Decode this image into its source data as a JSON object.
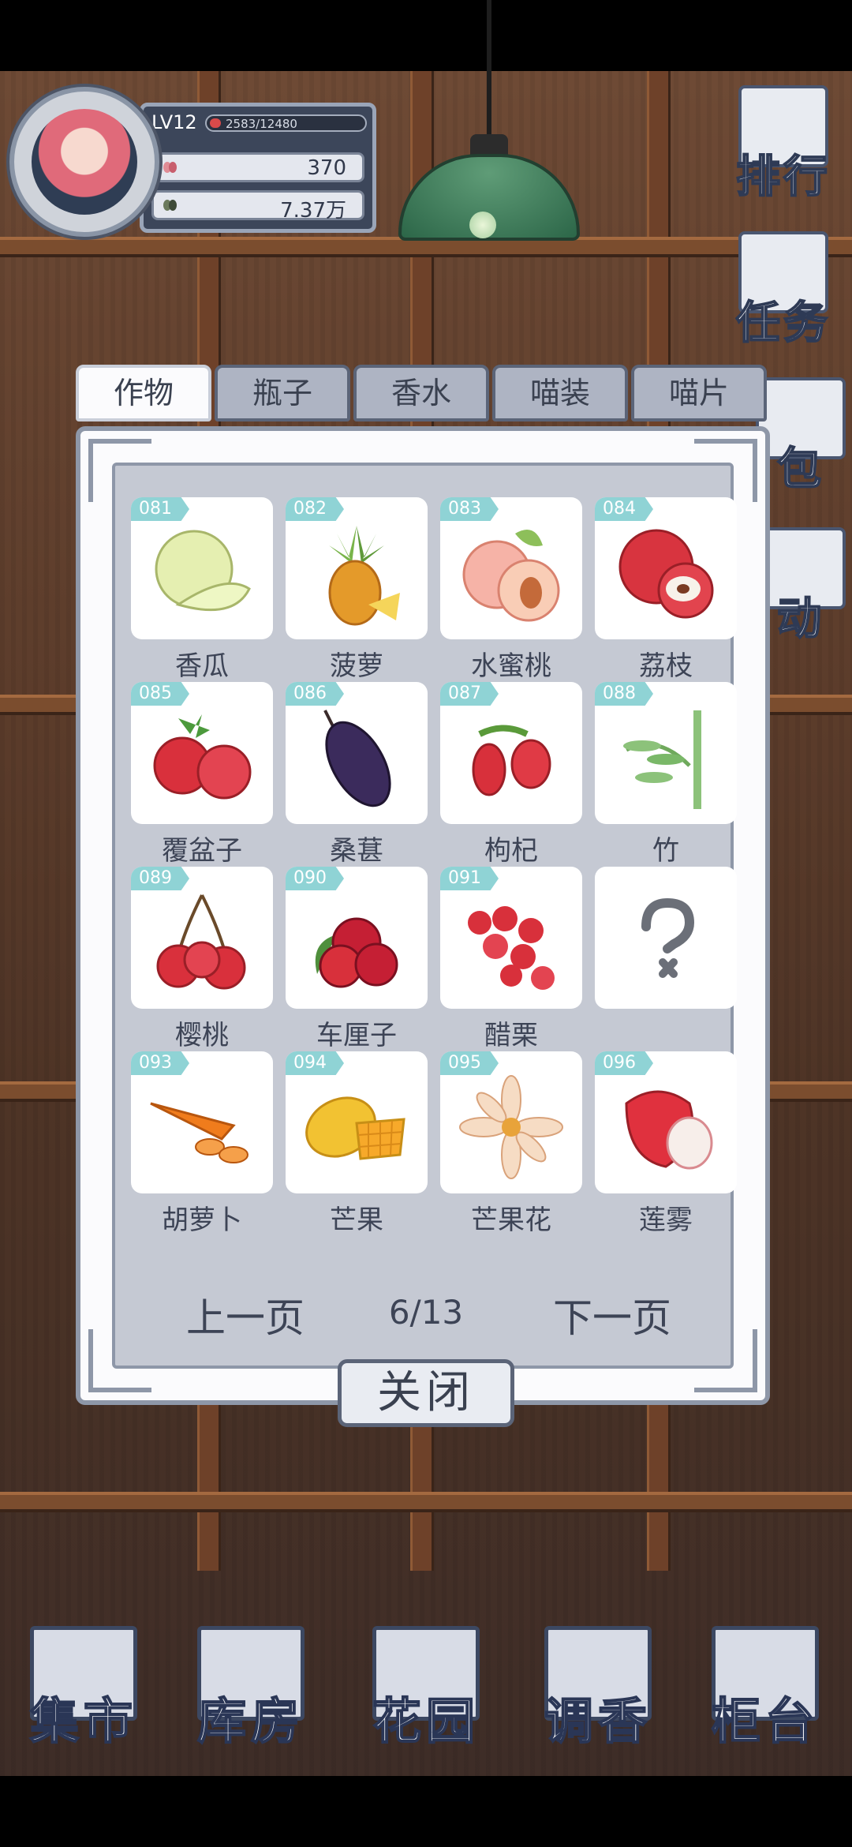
{
  "profile": {
    "level": "LV12",
    "exp": "2583/12480",
    "petals": "370",
    "leaves": "7.37万"
  },
  "side_menu": [
    {
      "label": "排行",
      "icon": "ranking-icon"
    },
    {
      "label": "任务",
      "icon": "task-icon"
    },
    {
      "label": "包",
      "icon": "bag-icon"
    },
    {
      "label": "动",
      "icon": "activity-icon"
    }
  ],
  "tabs": [
    {
      "label": "作物",
      "active": true
    },
    {
      "label": "瓶子",
      "active": false
    },
    {
      "label": "香水",
      "active": false
    },
    {
      "label": "喵装",
      "active": false
    },
    {
      "label": "喵片",
      "active": false
    }
  ],
  "items": [
    {
      "num": "081",
      "name": "香瓜",
      "icon": "melon-icon"
    },
    {
      "num": "082",
      "name": "菠萝",
      "icon": "pineapple-icon"
    },
    {
      "num": "083",
      "name": "水蜜桃",
      "icon": "peach-icon"
    },
    {
      "num": "084",
      "name": "荔枝",
      "icon": "lychee-icon"
    },
    {
      "num": "085",
      "name": "覆盆子",
      "icon": "raspberry-icon"
    },
    {
      "num": "086",
      "name": "桑葚",
      "icon": "mulberry-icon"
    },
    {
      "num": "087",
      "name": "枸杞",
      "icon": "goji-icon"
    },
    {
      "num": "088",
      "name": "竹",
      "icon": "bamboo-icon"
    },
    {
      "num": "089",
      "name": "樱桃",
      "icon": "cherry-icon"
    },
    {
      "num": "090",
      "name": "车厘子",
      "icon": "sweet-cherry-icon"
    },
    {
      "num": "091",
      "name": "醋栗",
      "icon": "currant-icon"
    },
    {
      "num": "",
      "name": "",
      "icon": "question-mark-icon"
    },
    {
      "num": "093",
      "name": "胡萝卜",
      "icon": "carrot-icon"
    },
    {
      "num": "094",
      "name": "芒果",
      "icon": "mango-icon"
    },
    {
      "num": "095",
      "name": "芒果花",
      "icon": "mango-flower-icon"
    },
    {
      "num": "096",
      "name": "莲雾",
      "icon": "wax-apple-icon"
    }
  ],
  "pager": {
    "prev": "上一页",
    "page": "6/13",
    "next": "下一页"
  },
  "close_label": "关闭",
  "bottom_nav": [
    {
      "label": "集市",
      "icon": "market-icon"
    },
    {
      "label": "库房",
      "icon": "warehouse-icon"
    },
    {
      "label": "花园",
      "icon": "garden-icon"
    },
    {
      "label": "调香",
      "icon": "perfume-mix-icon"
    },
    {
      "label": "柜台",
      "icon": "counter-icon"
    }
  ],
  "colors": {
    "accent_tag": "#8fd3d5",
    "panel_bg": "#c5c9d3",
    "frame": "#8e97a8"
  }
}
